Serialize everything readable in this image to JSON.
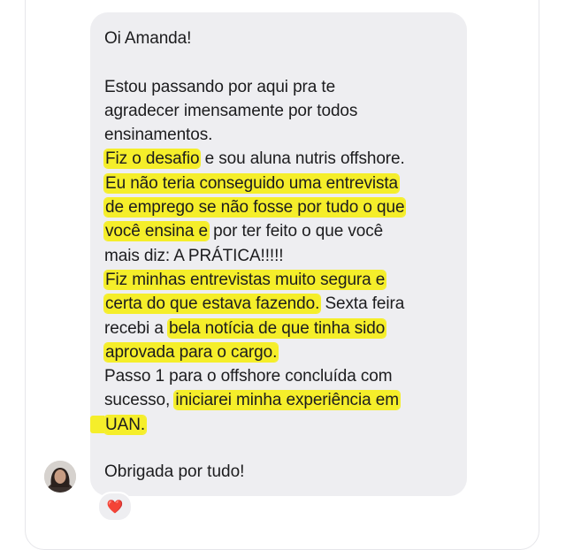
{
  "conversation": {
    "message_lines": [
      {
        "segments": [
          {
            "text": "Oi Amanda!",
            "highlight": false
          }
        ]
      },
      {
        "blank": true
      },
      {
        "segments": [
          {
            "text": "Estou passando por aqui pra te",
            "highlight": false
          }
        ]
      },
      {
        "segments": [
          {
            "text": "agradecer imensamente por todos",
            "highlight": false
          }
        ]
      },
      {
        "segments": [
          {
            "text": "ensinamentos.",
            "highlight": false
          }
        ]
      },
      {
        "segments": [
          {
            "text": "Fiz o desafio",
            "highlight": true
          },
          {
            "text": " e sou aluna nutris offshore.",
            "highlight": false
          }
        ]
      },
      {
        "segments": [
          {
            "text": "Eu não teria conseguido uma entrevista",
            "highlight": true
          }
        ]
      },
      {
        "segments": [
          {
            "text": "de emprego se não fosse por tudo o que",
            "highlight": true
          }
        ]
      },
      {
        "segments": [
          {
            "text": "você ensina e",
            "highlight": true
          },
          {
            "text": " por ter feito o que você",
            "highlight": false
          }
        ]
      },
      {
        "segments": [
          {
            "text": "mais diz: A PRÁTICA!!!!!",
            "highlight": false
          }
        ]
      },
      {
        "segments": [
          {
            "text": "Fiz minhas entrevistas muito segura e",
            "highlight": true
          }
        ]
      },
      {
        "segments": [
          {
            "text": "certa do que estava fazendo.",
            "highlight": true
          },
          {
            "text": " Sexta feira",
            "highlight": false
          }
        ]
      },
      {
        "segments": [
          {
            "text": "recebi a ",
            "highlight": false
          },
          {
            "text": "bela notícia de que tinha sido",
            "highlight": true
          }
        ]
      },
      {
        "segments": [
          {
            "text": "aprovada para o cargo.",
            "highlight": true
          }
        ]
      },
      {
        "segments": [
          {
            "text": "Passo 1 para o offshore concluída com",
            "highlight": false
          }
        ]
      },
      {
        "segments": [
          {
            "text": "sucesso, ",
            "highlight": false
          },
          {
            "text": "iniciarei minha experiência em",
            "highlight": true
          }
        ]
      },
      {
        "segments": [
          {
            "text": "UAN.",
            "highlight": true,
            "lead": true
          }
        ]
      }
    ],
    "final_message": "Obrigada por tudo!",
    "reaction": "❤️",
    "avatar_icon": "user-photo-avatar",
    "colors": {
      "bubble": "#eeeef1",
      "highlight": "#f5ee2a",
      "text": "#1c1c1e"
    }
  }
}
